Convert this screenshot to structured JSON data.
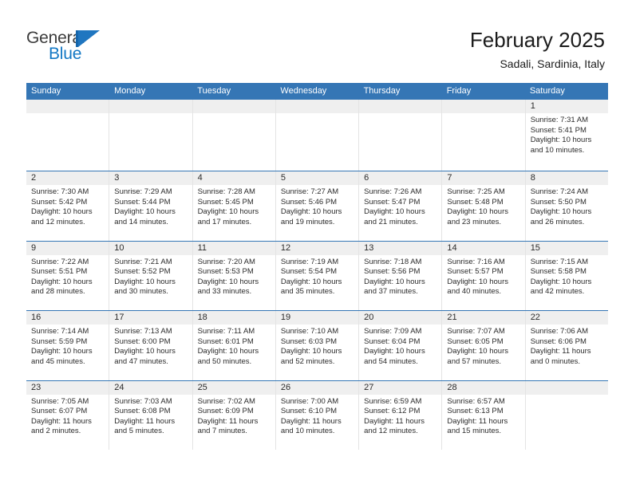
{
  "brand": {
    "name_top": "General",
    "name_bottom": "Blue",
    "accent_color": "#1f76c0",
    "header_color": "#3576b5"
  },
  "header": {
    "title": "February 2025",
    "subtitle": "Sadali, Sardinia, Italy"
  },
  "weekdays": [
    "Sunday",
    "Monday",
    "Tuesday",
    "Wednesday",
    "Thursday",
    "Friday",
    "Saturday"
  ],
  "weeks": [
    [
      {
        "day": "",
        "sunrise": "",
        "sunset": "",
        "daylight": "",
        "daylight2": "",
        "empty": true
      },
      {
        "day": "",
        "sunrise": "",
        "sunset": "",
        "daylight": "",
        "daylight2": "",
        "empty": true
      },
      {
        "day": "",
        "sunrise": "",
        "sunset": "",
        "daylight": "",
        "daylight2": "",
        "empty": true
      },
      {
        "day": "",
        "sunrise": "",
        "sunset": "",
        "daylight": "",
        "daylight2": "",
        "empty": true
      },
      {
        "day": "",
        "sunrise": "",
        "sunset": "",
        "daylight": "",
        "daylight2": "",
        "empty": true
      },
      {
        "day": "",
        "sunrise": "",
        "sunset": "",
        "daylight": "",
        "daylight2": "",
        "empty": true
      },
      {
        "day": "1",
        "sunrise": "Sunrise: 7:31 AM",
        "sunset": "Sunset: 5:41 PM",
        "daylight": "Daylight: 10 hours",
        "daylight2": "and 10 minutes."
      }
    ],
    [
      {
        "day": "2",
        "sunrise": "Sunrise: 7:30 AM",
        "sunset": "Sunset: 5:42 PM",
        "daylight": "Daylight: 10 hours",
        "daylight2": "and 12 minutes."
      },
      {
        "day": "3",
        "sunrise": "Sunrise: 7:29 AM",
        "sunset": "Sunset: 5:44 PM",
        "daylight": "Daylight: 10 hours",
        "daylight2": "and 14 minutes."
      },
      {
        "day": "4",
        "sunrise": "Sunrise: 7:28 AM",
        "sunset": "Sunset: 5:45 PM",
        "daylight": "Daylight: 10 hours",
        "daylight2": "and 17 minutes."
      },
      {
        "day": "5",
        "sunrise": "Sunrise: 7:27 AM",
        "sunset": "Sunset: 5:46 PM",
        "daylight": "Daylight: 10 hours",
        "daylight2": "and 19 minutes."
      },
      {
        "day": "6",
        "sunrise": "Sunrise: 7:26 AM",
        "sunset": "Sunset: 5:47 PM",
        "daylight": "Daylight: 10 hours",
        "daylight2": "and 21 minutes."
      },
      {
        "day": "7",
        "sunrise": "Sunrise: 7:25 AM",
        "sunset": "Sunset: 5:48 PM",
        "daylight": "Daylight: 10 hours",
        "daylight2": "and 23 minutes."
      },
      {
        "day": "8",
        "sunrise": "Sunrise: 7:24 AM",
        "sunset": "Sunset: 5:50 PM",
        "daylight": "Daylight: 10 hours",
        "daylight2": "and 26 minutes."
      }
    ],
    [
      {
        "day": "9",
        "sunrise": "Sunrise: 7:22 AM",
        "sunset": "Sunset: 5:51 PM",
        "daylight": "Daylight: 10 hours",
        "daylight2": "and 28 minutes."
      },
      {
        "day": "10",
        "sunrise": "Sunrise: 7:21 AM",
        "sunset": "Sunset: 5:52 PM",
        "daylight": "Daylight: 10 hours",
        "daylight2": "and 30 minutes."
      },
      {
        "day": "11",
        "sunrise": "Sunrise: 7:20 AM",
        "sunset": "Sunset: 5:53 PM",
        "daylight": "Daylight: 10 hours",
        "daylight2": "and 33 minutes."
      },
      {
        "day": "12",
        "sunrise": "Sunrise: 7:19 AM",
        "sunset": "Sunset: 5:54 PM",
        "daylight": "Daylight: 10 hours",
        "daylight2": "and 35 minutes."
      },
      {
        "day": "13",
        "sunrise": "Sunrise: 7:18 AM",
        "sunset": "Sunset: 5:56 PM",
        "daylight": "Daylight: 10 hours",
        "daylight2": "and 37 minutes."
      },
      {
        "day": "14",
        "sunrise": "Sunrise: 7:16 AM",
        "sunset": "Sunset: 5:57 PM",
        "daylight": "Daylight: 10 hours",
        "daylight2": "and 40 minutes."
      },
      {
        "day": "15",
        "sunrise": "Sunrise: 7:15 AM",
        "sunset": "Sunset: 5:58 PM",
        "daylight": "Daylight: 10 hours",
        "daylight2": "and 42 minutes."
      }
    ],
    [
      {
        "day": "16",
        "sunrise": "Sunrise: 7:14 AM",
        "sunset": "Sunset: 5:59 PM",
        "daylight": "Daylight: 10 hours",
        "daylight2": "and 45 minutes."
      },
      {
        "day": "17",
        "sunrise": "Sunrise: 7:13 AM",
        "sunset": "Sunset: 6:00 PM",
        "daylight": "Daylight: 10 hours",
        "daylight2": "and 47 minutes."
      },
      {
        "day": "18",
        "sunrise": "Sunrise: 7:11 AM",
        "sunset": "Sunset: 6:01 PM",
        "daylight": "Daylight: 10 hours",
        "daylight2": "and 50 minutes."
      },
      {
        "day": "19",
        "sunrise": "Sunrise: 7:10 AM",
        "sunset": "Sunset: 6:03 PM",
        "daylight": "Daylight: 10 hours",
        "daylight2": "and 52 minutes."
      },
      {
        "day": "20",
        "sunrise": "Sunrise: 7:09 AM",
        "sunset": "Sunset: 6:04 PM",
        "daylight": "Daylight: 10 hours",
        "daylight2": "and 54 minutes."
      },
      {
        "day": "21",
        "sunrise": "Sunrise: 7:07 AM",
        "sunset": "Sunset: 6:05 PM",
        "daylight": "Daylight: 10 hours",
        "daylight2": "and 57 minutes."
      },
      {
        "day": "22",
        "sunrise": "Sunrise: 7:06 AM",
        "sunset": "Sunset: 6:06 PM",
        "daylight": "Daylight: 11 hours",
        "daylight2": "and 0 minutes."
      }
    ],
    [
      {
        "day": "23",
        "sunrise": "Sunrise: 7:05 AM",
        "sunset": "Sunset: 6:07 PM",
        "daylight": "Daylight: 11 hours",
        "daylight2": "and 2 minutes."
      },
      {
        "day": "24",
        "sunrise": "Sunrise: 7:03 AM",
        "sunset": "Sunset: 6:08 PM",
        "daylight": "Daylight: 11 hours",
        "daylight2": "and 5 minutes."
      },
      {
        "day": "25",
        "sunrise": "Sunrise: 7:02 AM",
        "sunset": "Sunset: 6:09 PM",
        "daylight": "Daylight: 11 hours",
        "daylight2": "and 7 minutes."
      },
      {
        "day": "26",
        "sunrise": "Sunrise: 7:00 AM",
        "sunset": "Sunset: 6:10 PM",
        "daylight": "Daylight: 11 hours",
        "daylight2": "and 10 minutes."
      },
      {
        "day": "27",
        "sunrise": "Sunrise: 6:59 AM",
        "sunset": "Sunset: 6:12 PM",
        "daylight": "Daylight: 11 hours",
        "daylight2": "and 12 minutes."
      },
      {
        "day": "28",
        "sunrise": "Sunrise: 6:57 AM",
        "sunset": "Sunset: 6:13 PM",
        "daylight": "Daylight: 11 hours",
        "daylight2": "and 15 minutes."
      },
      {
        "day": "",
        "sunrise": "",
        "sunset": "",
        "daylight": "",
        "daylight2": "",
        "empty": true
      }
    ]
  ]
}
